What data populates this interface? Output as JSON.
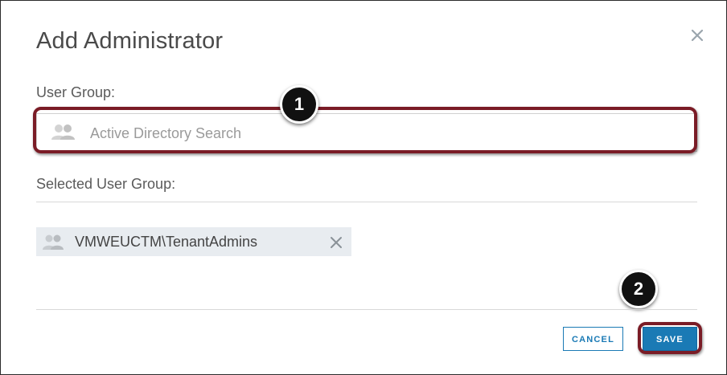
{
  "dialog": {
    "title": "Add Administrator",
    "close_icon": "close-icon"
  },
  "user_group": {
    "label": "User Group:",
    "search": {
      "placeholder": "Active Directory Search",
      "value": "",
      "icon": "users-icon"
    }
  },
  "selected": {
    "label": "Selected User Group:",
    "items": [
      {
        "name": "VMWEUCTM\\TenantAdmins",
        "icon": "users-icon",
        "remove_icon": "remove-icon"
      }
    ]
  },
  "buttons": {
    "cancel_label": "CANCEL",
    "save_label": "SAVE"
  },
  "annotations": {
    "step1": "1",
    "step2": "2",
    "highlight_color": "#7a1c26"
  },
  "colors": {
    "accent": "#1a7ab5",
    "chip_bg": "#e8ecf0"
  }
}
